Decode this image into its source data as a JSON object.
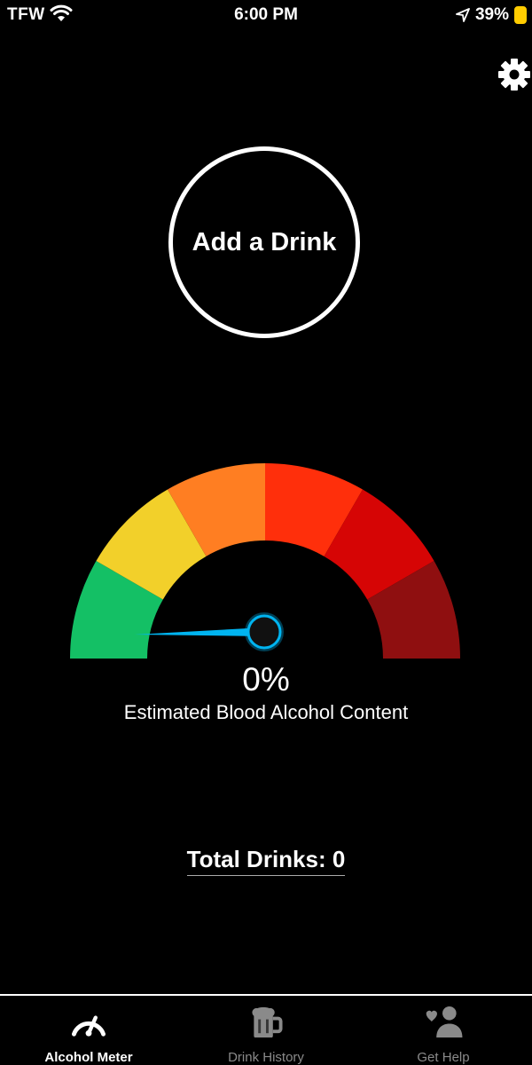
{
  "status_bar": {
    "carrier": "TFW",
    "time": "6:00 PM",
    "battery_percent": "39%",
    "battery_color": "#ffcc00",
    "icons": [
      "wifi-icon",
      "location-arrow-icon",
      "battery-icon"
    ]
  },
  "header": {
    "settings_icon": "gear-icon"
  },
  "add_drink": {
    "label": "Add a Drink"
  },
  "gauge": {
    "value_percent": 0,
    "segment_colors": [
      "#14c065",
      "#f2d02a",
      "#ff7e22",
      "#ff2f0b",
      "#d60505",
      "#8f0f10"
    ],
    "needle_color": "#00b4f0"
  },
  "bac": {
    "value": "0%",
    "label": "Estimated Blood Alcohol Content"
  },
  "total_drinks": {
    "label": "Total Drinks: 0"
  },
  "tabs": [
    {
      "label": "Alcohol Meter",
      "icon": "speedometer-icon",
      "active": true
    },
    {
      "label": "Drink History",
      "icon": "beer-mug-icon",
      "active": false
    },
    {
      "label": "Get Help",
      "icon": "person-heart-icon",
      "active": false
    }
  ]
}
